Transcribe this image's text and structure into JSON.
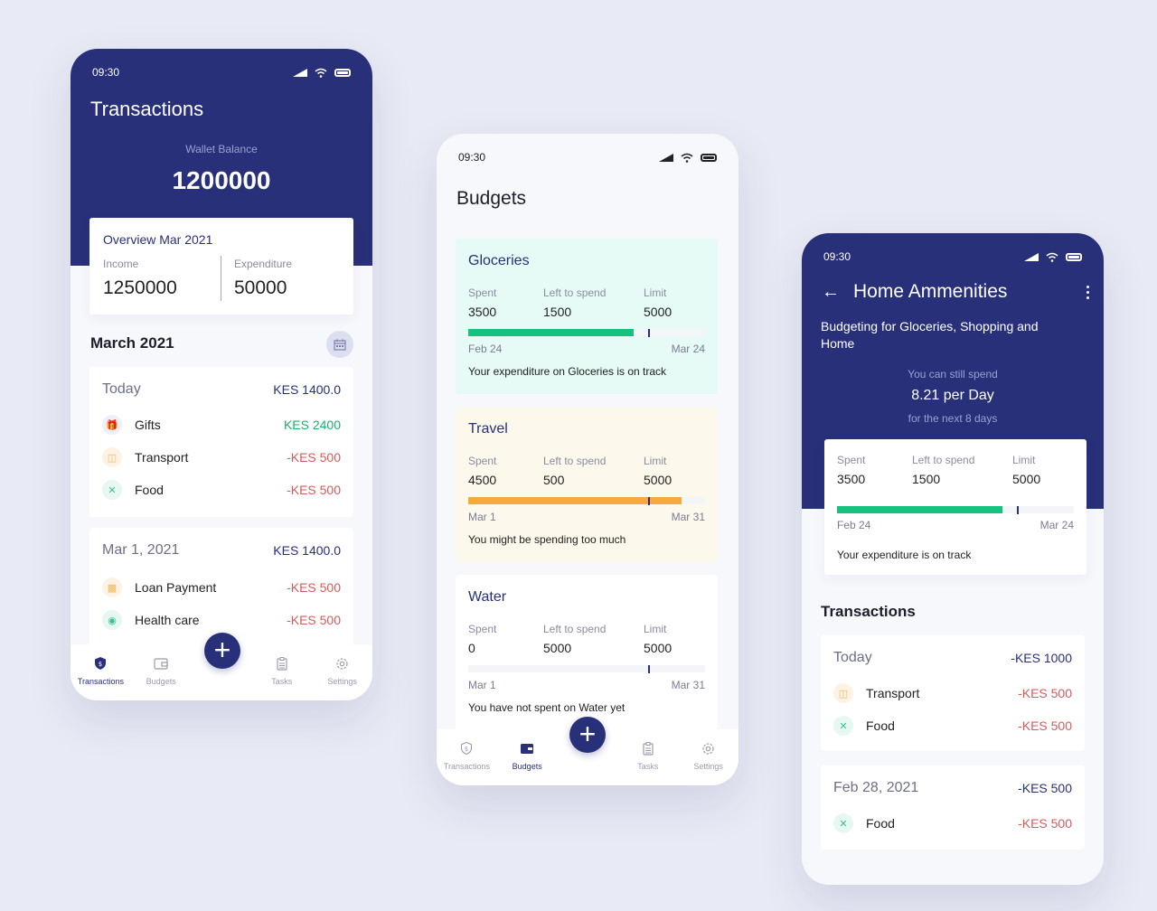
{
  "status_time": "09:30",
  "colors": {
    "primary": "#283079",
    "positive": "#1fae6e",
    "negative": "#d65b5b",
    "progress_green": "#17c17f",
    "progress_orange": "#f4ab3b",
    "groceries_bg": "#e6fbf5",
    "travel_bg": "#fdf8ec",
    "water_bg": "#ffffff"
  },
  "transactions_screen": {
    "title": "Transactions",
    "wallet_label": "Wallet Balance",
    "wallet_value": "1200000",
    "overview": {
      "title": "Overview Mar 2021",
      "income_label": "Income",
      "income_value": "1250000",
      "expenditure_label": "Expenditure",
      "expenditure_value": "50000"
    },
    "month_heading": "March 2021",
    "calendar_icon": "calendar-icon",
    "groups": [
      {
        "date": "Today",
        "total": "KES 1400.0",
        "items": [
          {
            "name": "Gifts",
            "amount": "KES 2400",
            "type": "pos",
            "icon": "gift-icon"
          },
          {
            "name": "Transport",
            "amount": "-KES 500",
            "type": "neg",
            "icon": "car-icon"
          },
          {
            "name": "Food",
            "amount": "-KES 500",
            "type": "neg",
            "icon": "cutlery-icon"
          }
        ]
      },
      {
        "date": "Mar 1, 2021",
        "total": "KES 1400.0",
        "items": [
          {
            "name": "Loan Payment",
            "amount": "-KES 500",
            "type": "neg",
            "icon": "loan-icon"
          },
          {
            "name": "Health care",
            "amount": "-KES 500",
            "type": "neg",
            "icon": "health-icon"
          }
        ]
      }
    ]
  },
  "nav": {
    "transactions": "Transactions",
    "budgets": "Budgets",
    "tasks": "Tasks",
    "settings": "Settings",
    "fab": "+"
  },
  "budgets_screen": {
    "title": "Budgets",
    "labels": {
      "spent": "Spent",
      "left": "Left to spend",
      "limit": "Limit"
    },
    "budgets": [
      {
        "name": "Gloceries",
        "spent": "3500",
        "left": "1500",
        "limit": "5000",
        "progress": 0.7,
        "time_marker": 0.76,
        "start": "Feb 24",
        "end": "Mar 24",
        "message": "Your expenditure on Gloceries is on track",
        "color": "green"
      },
      {
        "name": "Travel",
        "spent": "4500",
        "left": "500",
        "limit": "5000",
        "progress": 0.9,
        "time_marker": 0.76,
        "start": "Mar 1",
        "end": "Mar 31",
        "message": "You might be spending too much",
        "color": "orange"
      },
      {
        "name": "Water",
        "spent": "0",
        "left": "5000",
        "limit": "5000",
        "progress": 0,
        "time_marker": 0.76,
        "start": "Mar 1",
        "end": "Mar 31",
        "message": "You have not spent on Water yet",
        "color": "none"
      }
    ]
  },
  "detail_screen": {
    "title": "Home Ammenities",
    "description": "Budgeting for Gloceries, Shopping and Home",
    "still_spend_label": "You can still spend",
    "rate": "8.21 per Day",
    "next_label": "for the next 8 days",
    "budget": {
      "spent": "3500",
      "left": "1500",
      "limit": "5000",
      "progress": 0.7,
      "time_marker": 0.76,
      "start": "Feb 24",
      "end": "Mar 24",
      "message": "Your expenditure is on track"
    },
    "transactions_heading": "Transactions",
    "groups": [
      {
        "date": "Today",
        "total": "-KES 1000",
        "items": [
          {
            "name": "Transport",
            "amount": "-KES 500",
            "type": "neg",
            "icon": "car-icon"
          },
          {
            "name": "Food",
            "amount": "-KES 500",
            "type": "neg",
            "icon": "cutlery-icon"
          }
        ]
      },
      {
        "date": "Feb 28, 2021",
        "total": "-KES 500",
        "items": [
          {
            "name": "Food",
            "amount": "-KES 500",
            "type": "neg",
            "icon": "cutlery-icon"
          }
        ]
      }
    ]
  }
}
